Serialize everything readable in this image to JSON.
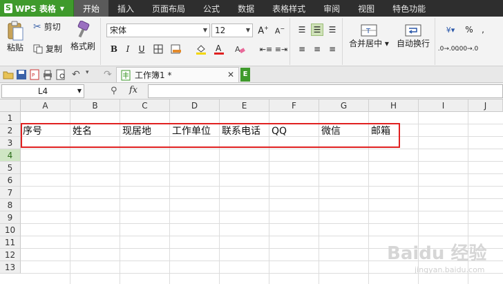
{
  "app": {
    "name": "WPS 表格"
  },
  "menu": {
    "tabs": [
      "开始",
      "插入",
      "页面布局",
      "公式",
      "数据",
      "表格样式",
      "审阅",
      "视图",
      "特色功能"
    ]
  },
  "ribbon": {
    "paste_label": "粘贴",
    "cut_label": "剪切",
    "copy_label": "复制",
    "format_painter_label": "格式刷",
    "font_name": "宋体",
    "font_size": "12",
    "merge_center_label": "合并居中",
    "wrap_text_label": "自动换行",
    "bold": "B",
    "italic": "I",
    "underline": "U",
    "percent": "%",
    "comma": ","
  },
  "document": {
    "tab_title": "工作簿1 *"
  },
  "formula_bar": {
    "cell_ref": "L4",
    "fx": "fx",
    "value": ""
  },
  "sheet": {
    "columns": [
      "A",
      "B",
      "C",
      "D",
      "E",
      "F",
      "G",
      "H",
      "I",
      "J"
    ],
    "rows": [
      "1",
      "2",
      "3",
      "4",
      "5",
      "6",
      "7",
      "8",
      "9",
      "10",
      "11",
      "12",
      "13"
    ],
    "active_row": "4",
    "row2_cells": [
      "序号",
      "姓名",
      "现居地",
      "工作单位",
      "联系电话",
      "QQ",
      "微信",
      "邮箱"
    ]
  },
  "watermark": {
    "main": "Baidu 经验",
    "sub": "jingyan.baidu.com"
  },
  "colors": {
    "accent_green": "#3f9a2c",
    "highlight_red": "#e02020",
    "menubar": "#2e2e2e"
  }
}
